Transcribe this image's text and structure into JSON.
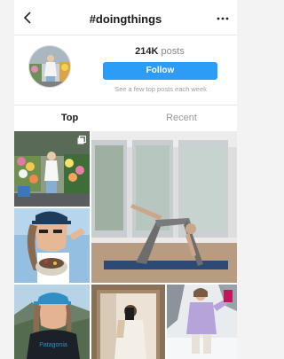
{
  "header": {
    "title": "#doingthings",
    "back_icon": "chevron-left-icon",
    "more_icon": "more-horizontal-icon"
  },
  "hashtag": {
    "posts_value": "214K",
    "posts_label": "posts",
    "follow_label": "Follow",
    "note": "See a few top posts each week"
  },
  "tabs": [
    {
      "label": "Top",
      "active": true
    },
    {
      "label": "Recent",
      "active": false
    }
  ],
  "colors": {
    "accent": "#2d9cf6",
    "tab_active": "#1a1a1a",
    "tab_inactive": "#9a9a9a"
  },
  "grid": {
    "posts": [
      {
        "subject": "woman by flower stand",
        "multi_icon": "multiple-images-icon"
      },
      {
        "subject": "woman doing yoga pose"
      },
      {
        "subject": "woman eating from bowl"
      },
      {
        "subject": "woman in blue cap on mountain",
        "cap_text": "Patagonia"
      },
      {
        "subject": "mirror selfie"
      },
      {
        "subject": "woman in snow"
      }
    ]
  }
}
